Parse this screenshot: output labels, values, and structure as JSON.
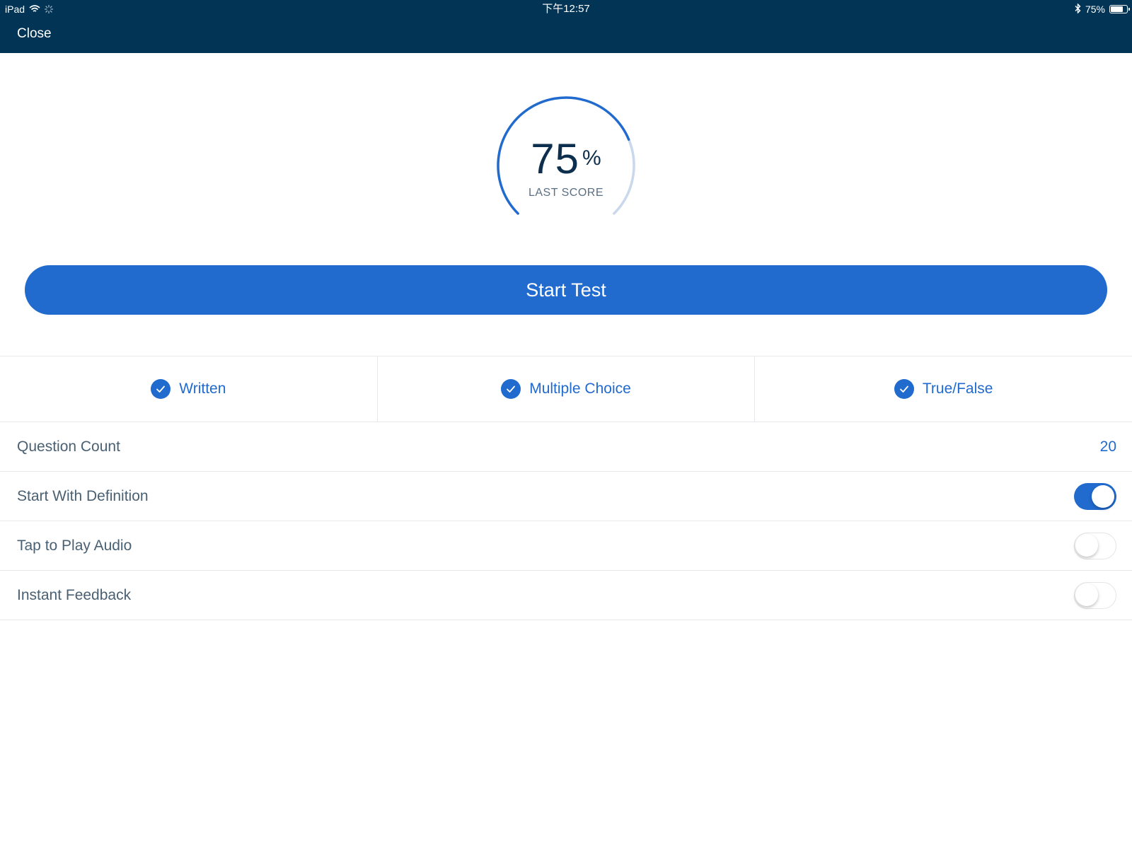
{
  "status_bar": {
    "device": "iPad",
    "time": "下午12:57",
    "battery_percent": "75%",
    "battery_level": 0.75,
    "icons": [
      "wifi-icon",
      "loading-spinner-icon",
      "bluetooth-icon",
      "battery-icon"
    ]
  },
  "nav": {
    "close_label": "Close"
  },
  "score": {
    "value": "75",
    "unit": "%",
    "label": "LAST SCORE",
    "fraction": 0.75
  },
  "start_button": {
    "label": "Start Test"
  },
  "question_types": [
    {
      "label": "Written",
      "checked": true
    },
    {
      "label": "Multiple Choice",
      "checked": true
    },
    {
      "label": "True/False",
      "checked": true
    }
  ],
  "settings": {
    "question_count": {
      "label": "Question Count",
      "value": "20"
    },
    "start_with_definition": {
      "label": "Start With Definition",
      "enabled": true
    },
    "tap_to_play_audio": {
      "label": "Tap to Play Audio",
      "enabled": false
    },
    "instant_feedback": {
      "label": "Instant Feedback",
      "enabled": false
    }
  },
  "colors": {
    "header_bg": "#023456",
    "accent": "#216ace",
    "arc_track": "#c9d8ec",
    "text_secondary": "#4a6073",
    "divider": "#e6e8eb"
  }
}
